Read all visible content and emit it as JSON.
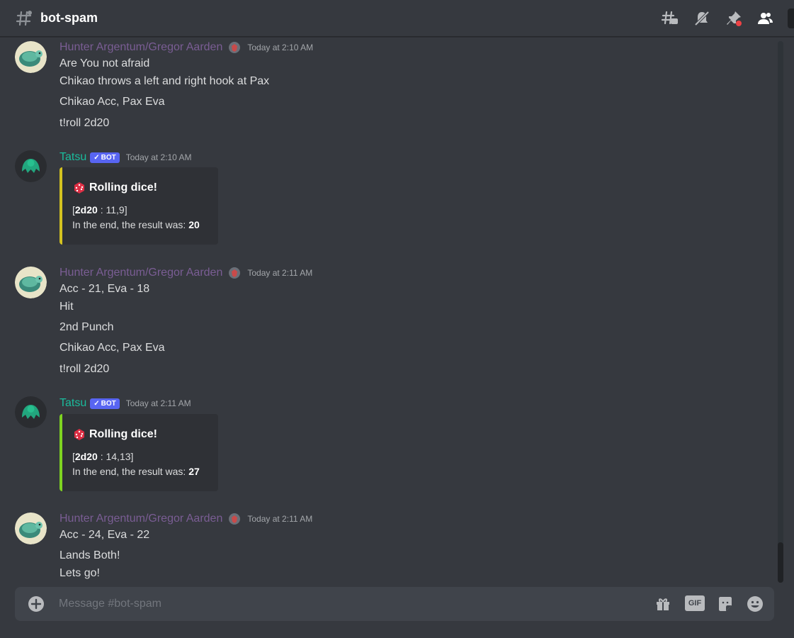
{
  "header": {
    "channel_name": "bot-spam"
  },
  "messages": [
    {
      "author": "Hunter Argentum/Gregor Aarden",
      "timestamp": "Today at 2:10 AM",
      "lines": [
        "Are You not afraid",
        "Chikao throws a left and right hook at Pax",
        "Chikao Acc, Pax Eva",
        "t!roll 2d20"
      ]
    },
    {
      "author": "Tatsu",
      "bot_tag": "BOT",
      "timestamp": "Today at 2:10 AM",
      "embed": {
        "title": "Rolling dice!",
        "dice": "2d20",
        "rolls": " : 11,9]",
        "result_label": "In the end, the result was: ",
        "result": "20",
        "color": "#d4c220"
      }
    },
    {
      "author": "Hunter Argentum/Gregor Aarden",
      "timestamp": "Today at 2:11 AM",
      "lines": [
        "Acc - 21, Eva - 18",
        "Hit",
        "2nd Punch",
        "Chikao Acc, Pax Eva",
        "t!roll 2d20"
      ]
    },
    {
      "author": "Tatsu",
      "bot_tag": "BOT",
      "timestamp": "Today at 2:11 AM",
      "embed": {
        "title": "Rolling dice!",
        "dice": "2d20",
        "rolls": " : 14,13]",
        "result_label": "In the end, the result was: ",
        "result": "27",
        "color": "#7ed321"
      }
    },
    {
      "author": "Hunter Argentum/Gregor Aarden",
      "timestamp": "Today at 2:11 AM",
      "lines": [
        "Acc - 24, Eva - 22",
        "Lands Both!",
        "Lets go!"
      ]
    }
  ],
  "composer": {
    "placeholder": "Message #bot-spam",
    "gif_label": "GIF"
  },
  "icons": {
    "header": [
      "threads-icon",
      "notification-muted-icon",
      "pin-icon",
      "members-icon"
    ],
    "composer": [
      "add-attachment-icon",
      "gift-icon",
      "gif-icon",
      "sticker-icon",
      "emoji-icon"
    ]
  },
  "colors": {
    "background": "#36393f",
    "hunter_name": "#7a5d94",
    "bot_name": "#1abc9c",
    "bot_tag": "#5865f2",
    "embed_bg": "#2f3136"
  }
}
